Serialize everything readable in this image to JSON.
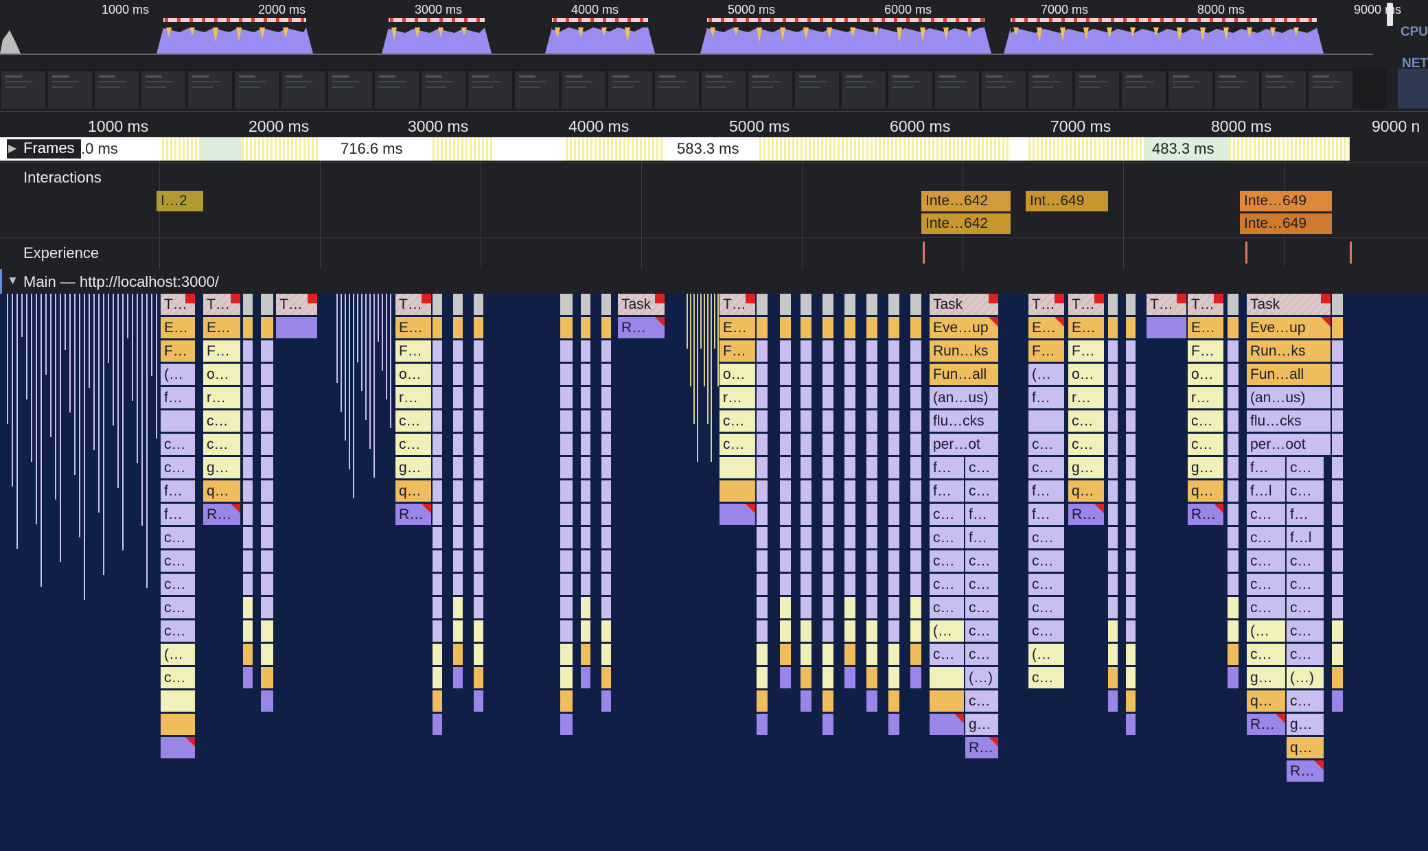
{
  "overview": {
    "ticks": [
      "1000 ms",
      "2000 ms",
      "3000 ms",
      "4000 ms",
      "5000 ms",
      "6000 ms",
      "7000 ms",
      "8000 ms",
      "9000 ms"
    ],
    "cpu_label": "CPU",
    "net_label": "NET"
  },
  "ruler": {
    "ticks": [
      "1000 ms",
      "2000 ms",
      "3000 ms",
      "4000 ms",
      "5000 ms",
      "6000 ms",
      "7000 ms",
      "8000 ms",
      "9000 n"
    ]
  },
  "tracks": {
    "frames": {
      "label": "Frames",
      "durations": [
        ".0 ms",
        "716.6 ms",
        "583.3 ms",
        "483.3 ms"
      ]
    },
    "interactions": {
      "label": "Interactions",
      "items": [
        "I…2",
        "Inte…642",
        "Inte…642",
        "Int…649",
        "Inte…649",
        "Inte…649"
      ]
    },
    "experience": {
      "label": "Experience"
    },
    "main": {
      "label": "Main — http://localhost:3000/"
    }
  },
  "flame": {
    "colors": {
      "task": "#c8c8c8",
      "event": "#f0bd5c",
      "function": "#c8bff0",
      "render": "#9a85e8",
      "script": "#f0f0b8",
      "background": "#0f1f45"
    },
    "labels": {
      "blockA": [
        "T…",
        "E…",
        "F…",
        "(…",
        "f…",
        "",
        "c…",
        "c…",
        "f…",
        "f…",
        "c…",
        "c…",
        "c…",
        "c…",
        "c…",
        "(…",
        "c…"
      ],
      "blockB": [
        "T…",
        "E…",
        "F…",
        "o…",
        "r…",
        "c…",
        "c…",
        "g…",
        "q…",
        "R…"
      ],
      "blockC": [
        "T…"
      ],
      "blockD": [
        "T…",
        "E…",
        "F…",
        "o…",
        "r…",
        "c…",
        "c…",
        "g…",
        "q…",
        "R…"
      ],
      "blockE": [
        "Task",
        "R…"
      ],
      "blockF": [
        "T…",
        "E…",
        "F…",
        "o…",
        "r…",
        "c…",
        "c…"
      ],
      "blockG": {
        "rows": [
          "Task",
          "Eve…up",
          "Run…ks",
          "Fun…all",
          "(an…us)",
          "flu…cks",
          "per…ot"
        ],
        "left": [
          "f…",
          "f…",
          "c…",
          "c…",
          "c…",
          "c…",
          "c…",
          "(…",
          "c…"
        ],
        "right": [
          "c…",
          "c…",
          "f…",
          "f…",
          "c…",
          "c…",
          "c…",
          "c…",
          "c…",
          "(…)",
          "c…",
          "g…",
          "R…"
        ]
      },
      "blockH": [
        "T…",
        "",
        "F…",
        "(…",
        "f…",
        "",
        "c…",
        "c…",
        "f…",
        "f…",
        "c…",
        "c…",
        "c…",
        "c…",
        "c…",
        "(…",
        "c…"
      ],
      "blockI": [
        "T…",
        "E…",
        "F…",
        "o…",
        "r…",
        "c…",
        "c…",
        "g…",
        "q…",
        "R…"
      ],
      "blockJ": [
        "T…"
      ],
      "blockK": [
        "T…",
        "E…",
        "F…",
        "o…",
        "r…",
        "c…",
        "c…",
        "g…",
        "q…",
        "R…"
      ],
      "blockL": {
        "rows": [
          "Task",
          "Eve…up",
          "Run…ks",
          "Fun…all",
          "(an…us)",
          "flu…cks",
          "per…oot"
        ],
        "left": [
          "f…",
          "f…l",
          "c…",
          "c…",
          "c…",
          "c…",
          "c…",
          "(…",
          "c…",
          "g…",
          "q…",
          "R…"
        ],
        "right": [
          "c…",
          "c…",
          "f…",
          "f…l",
          "c…",
          "c…",
          "c…",
          "c…",
          "c…",
          "(…)",
          "c…",
          "g…",
          "q…",
          "R…"
        ]
      }
    }
  }
}
